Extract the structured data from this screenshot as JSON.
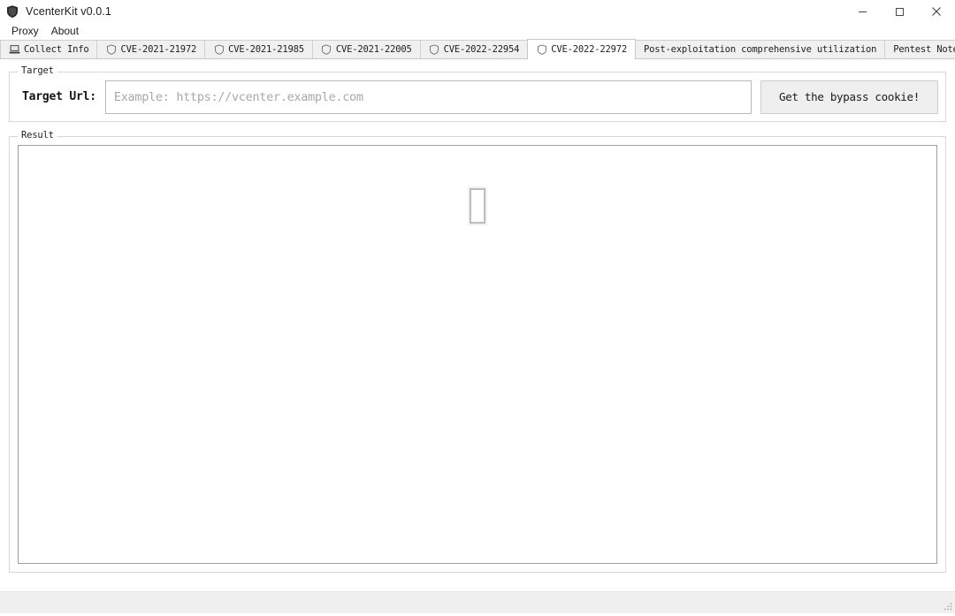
{
  "window": {
    "title": "VcenterKit v0.0.1",
    "app_icon": "shield-icon",
    "controls": {
      "minimize": "minimize-icon",
      "maximize": "maximize-icon",
      "close": "close-icon"
    }
  },
  "menubar": {
    "items": [
      {
        "label": "Proxy"
      },
      {
        "label": "About"
      }
    ]
  },
  "tabs": [
    {
      "label": "Collect Info",
      "icon": "computer-icon",
      "active": false
    },
    {
      "label": "CVE-2021-21972",
      "icon": "shield-outline-icon",
      "active": false
    },
    {
      "label": "CVE-2021-21985",
      "icon": "shield-outline-icon",
      "active": false
    },
    {
      "label": "CVE-2021-22005",
      "icon": "shield-outline-icon",
      "active": false
    },
    {
      "label": "CVE-2022-22954",
      "icon": "shield-outline-icon",
      "active": false
    },
    {
      "label": "CVE-2022-22972",
      "icon": "shield-outline-icon",
      "active": true
    },
    {
      "label": "Post-exploitation comprehensive utilization",
      "icon": "",
      "active": false
    },
    {
      "label": "Pentest Notebook",
      "icon": "",
      "active": false
    }
  ],
  "target": {
    "group_title": "Target",
    "url_label": "Target Url:",
    "url_value": "",
    "url_placeholder": "Example: https://vcenter.example.com",
    "button_label": "Get the bypass cookie!"
  },
  "result": {
    "group_title": "Result",
    "content": "",
    "placeholder_glyph": "missing-glyph-box"
  },
  "statusbar": {
    "text": "",
    "grip": "resize-grip-icon"
  },
  "colors": {
    "window_bg": "#ffffff",
    "tab_inactive_bg": "#f0f0f0",
    "tab_active_bg": "#ffffff",
    "button_bg": "#efefef",
    "border": "#d6d6d6",
    "statusbar_bg": "#f0f0f0",
    "placeholder_text": "#a8a8a8"
  }
}
